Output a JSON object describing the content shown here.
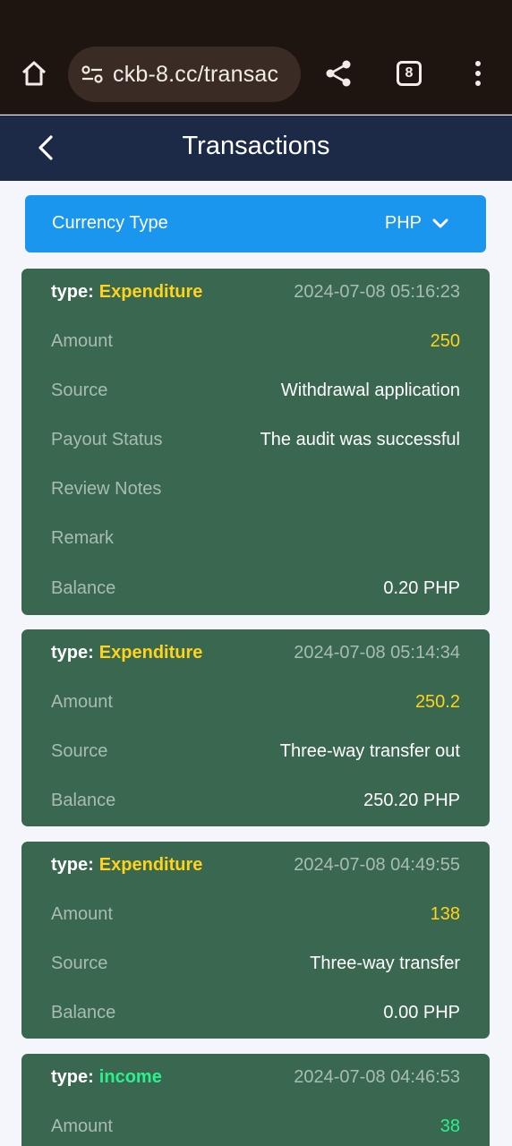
{
  "browser": {
    "url": "ckb-8.cc/transac",
    "tab_count": "8"
  },
  "header": {
    "title": "Transactions"
  },
  "currency": {
    "label": "Currency Type",
    "value": "PHP"
  },
  "colors": {
    "card_bg": "#39674f",
    "header_bg": "#1c2a47",
    "accent_blue": "#1a96ef",
    "expenditure": "#ffd31a",
    "income": "#2cf08c"
  },
  "transactions": [
    {
      "type_label": "type:",
      "type": "Expenditure",
      "datetime": "2024-07-08 05:16:23",
      "rows": [
        {
          "key": "Amount",
          "value": "250"
        },
        {
          "key": "Source",
          "value": "Withdrawal application"
        },
        {
          "key": "Payout Status",
          "value": "The audit was successful"
        },
        {
          "key": "Review Notes",
          "value": ""
        },
        {
          "key": "Remark",
          "value": ""
        },
        {
          "key": "Balance",
          "value": "0.20 PHP"
        }
      ]
    },
    {
      "type_label": "type:",
      "type": "Expenditure",
      "datetime": "2024-07-08 05:14:34",
      "rows": [
        {
          "key": "Amount",
          "value": "250.2"
        },
        {
          "key": "Source",
          "value": "Three-way transfer out"
        },
        {
          "key": "Balance",
          "value": "250.20 PHP"
        }
      ]
    },
    {
      "type_label": "type:",
      "type": "Expenditure",
      "datetime": "2024-07-08 04:49:55",
      "rows": [
        {
          "key": "Amount",
          "value": "138"
        },
        {
          "key": "Source",
          "value": "Three-way transfer"
        },
        {
          "key": "Balance",
          "value": "0.00 PHP"
        }
      ]
    },
    {
      "type_label": "type:",
      "type": "income",
      "datetime": "2024-07-08 04:46:53",
      "rows": [
        {
          "key": "Amount",
          "value": "38"
        }
      ]
    }
  ]
}
